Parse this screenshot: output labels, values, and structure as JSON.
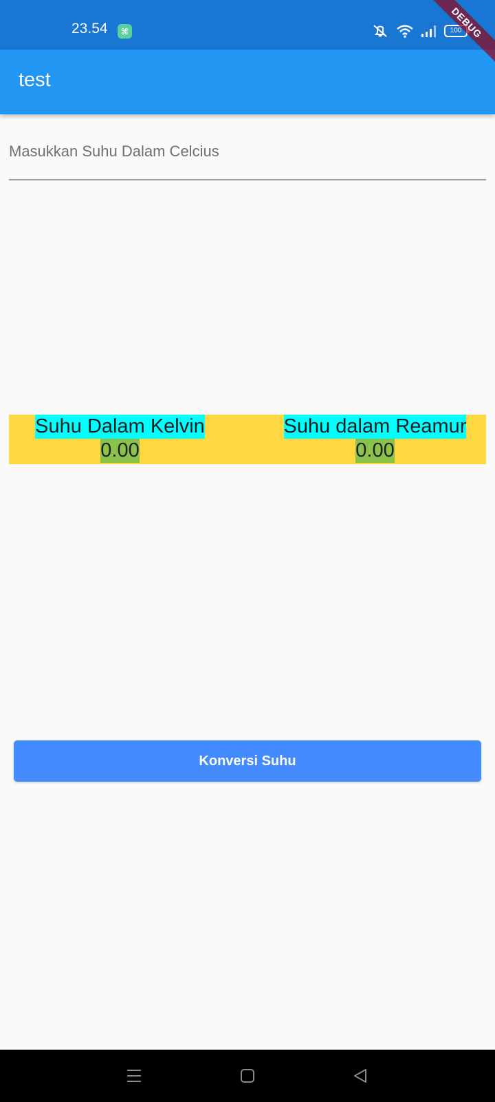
{
  "status_bar": {
    "time": "23.54",
    "battery_level": "100",
    "icons": [
      "notification-app-icon",
      "mute-icon",
      "wifi-icon",
      "signal-icon",
      "battery-icon"
    ],
    "color": "#1976d2"
  },
  "debug_banner": {
    "label": "DEBUG"
  },
  "app_bar": {
    "title": "test",
    "color": "#2196f3"
  },
  "input": {
    "placeholder": "Masukkan Suhu Dalam Celcius",
    "value": ""
  },
  "results": {
    "kelvin": {
      "label": "Suhu Dalam Kelvin",
      "value": "0.00"
    },
    "reamur": {
      "label": "Suhu dalam Reamur",
      "value": "0.00"
    },
    "panel_color": "#ffd740",
    "label_bg": "#00ffff",
    "value_bg": "#8bc34a"
  },
  "button": {
    "label": "Konversi Suhu",
    "color": "#448aff"
  },
  "nav_bar": {
    "icons": [
      "menu-icon",
      "home-icon",
      "back-icon"
    ]
  }
}
